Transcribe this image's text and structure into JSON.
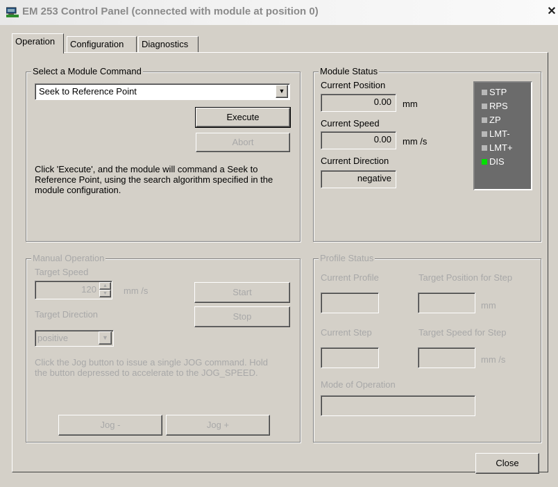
{
  "window": {
    "title": "EM 253 Control Panel (connected with module at position 0)"
  },
  "tabs": [
    {
      "label": "Operation"
    },
    {
      "label": "Configuration"
    },
    {
      "label": "Diagnostics"
    }
  ],
  "command": {
    "legend": "Select a Module Command",
    "selected": "Seek to Reference Point",
    "execute_label": "Execute",
    "abort_label": "Abort",
    "description": "Click 'Execute', and the module will command a Seek to Reference Point, using the search algorithm specified in the module configuration."
  },
  "module_status": {
    "legend": "Module Status",
    "position_label": "Current Position",
    "position_value": "0.00",
    "position_unit": "mm",
    "speed_label": "Current Speed",
    "speed_value": "0.00",
    "speed_unit": "mm /s",
    "direction_label": "Current Direction",
    "direction_value": "negative",
    "indicators": [
      {
        "label": "STP",
        "color": "#b8b8b8"
      },
      {
        "label": "RPS",
        "color": "#b8b8b8"
      },
      {
        "label": "ZP",
        "color": "#b8b8b8"
      },
      {
        "label": "LMT-",
        "color": "#b8b8b8"
      },
      {
        "label": "LMT+",
        "color": "#b8b8b8"
      },
      {
        "label": "DIS",
        "color": "#00e000"
      }
    ]
  },
  "manual": {
    "legend": "Manual Operation",
    "speed_label": "Target Speed",
    "speed_value": "120",
    "speed_unit": "mm /s",
    "start_label": "Start",
    "stop_label": "Stop",
    "direction_label": "Target Direction",
    "direction_value": "positive",
    "description": "Click the Jog button to issue a single JOG command. Hold the button depressed to accelerate to the JOG_SPEED.",
    "jog_minus_label": "Jog -",
    "jog_plus_label": "Jog +"
  },
  "profile": {
    "legend": "Profile Status",
    "current_profile_label": "Current Profile",
    "target_position_label": "Target Position for Step",
    "target_position_unit": "mm",
    "current_step_label": "Current Step",
    "target_speed_label": "Target Speed for Step",
    "target_speed_unit": "mm /s",
    "mode_label": "Mode of Operation"
  },
  "footer": {
    "close_label": "Close"
  }
}
